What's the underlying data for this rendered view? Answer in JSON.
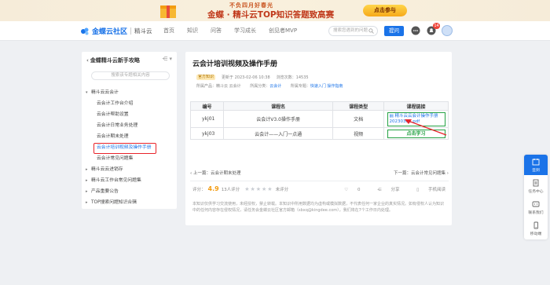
{
  "banner": {
    "subtitle": "不负四月好春光",
    "title": "金蝶 · 精斗云TOP知识答题致高赛",
    "cta": "点击参与"
  },
  "nav": {
    "brand": "金蝶云社区",
    "sub": "精斗云",
    "menu": [
      "首页",
      "知识",
      "问答",
      "学习成长",
      "创见者MVP"
    ],
    "search_placeholder": "搜索您遇到的问题",
    "ask_button": "提问",
    "notification_count": "14"
  },
  "sidebar": {
    "title": "金蝶精斗云新手攻略",
    "search_placeholder": "搜索该专题相关内容",
    "items": [
      {
        "label": "精斗云云会计",
        "level": 1,
        "caret": "▾"
      },
      {
        "label": "云会计工作台介绍",
        "level": 2
      },
      {
        "label": "云会计帮助设置",
        "level": 2
      },
      {
        "label": "云会计日常业务处理",
        "level": 2
      },
      {
        "label": "云会计期末处理",
        "level": 2
      },
      {
        "label": "云会计培训视频及操作手册",
        "level": 2,
        "active": true
      },
      {
        "label": "云会计常见问题集",
        "level": 2
      },
      {
        "label": "精斗云云进销存",
        "level": 1,
        "caret": "▸"
      },
      {
        "label": "精斗云工作台常见问题集",
        "level": 1,
        "caret": "▸"
      },
      {
        "label": "产品重要公告",
        "level": 1,
        "caret": "▸"
      },
      {
        "label": "TOP搜索问题知识合辑",
        "level": 1,
        "caret": "▸"
      }
    ]
  },
  "doc": {
    "title": "云会计培训视频及操作手册",
    "tag": "官方知识",
    "updated": "更新于 2023-02-06 10:38",
    "views": "浏览次数：14535",
    "product_label": "所属产品：",
    "product": "精斗云 云会计",
    "category_label": "所属分类：",
    "category": "云会计",
    "topic_label": "所属专题：",
    "topics": "快速入门  操作指南"
  },
  "table": {
    "headers": [
      "编号",
      "课程名",
      "课程类型",
      "课程链接"
    ],
    "rows": [
      {
        "no": "ykj01",
        "name": "云会计V3.0操作手册",
        "type": "文档",
        "link": "精斗云云会计操作手册20230301.pdf",
        "link_icon": "document-icon"
      },
      {
        "no": "ykj03",
        "name": "云会计——入门一点通",
        "type": "视频",
        "link": "点击学习"
      }
    ]
  },
  "pager": {
    "prev": "上一篇：云会计期末处理",
    "next": "下一篇：云会计常见问题集"
  },
  "rating": {
    "label": "评分：",
    "score": "4.9",
    "count": "13人评分",
    "stars": "★★★★★",
    "unrated": "未评分"
  },
  "actions": {
    "like": "0",
    "share": "分享",
    "mobile": "手机阅读"
  },
  "disclaimer": "本知识仅供学习交流使用，未经授权，禁止转载。本知识中所用数据均为虚构或模拟数据，不代表任何一家企业的真实情况。如有侵权人认为知识中的任何内容存在侵权情况，请任务会金蝶云社区官方邮箱（sbxq@kingdee.com），我们将在7个工作日内处理。",
  "floatbar": [
    {
      "label": "签到",
      "icon": "checkin-icon"
    },
    {
      "label": "任务中心",
      "icon": "task-icon"
    },
    {
      "label": "联系我们",
      "icon": "contact-icon"
    },
    {
      "label": "移动端",
      "icon": "mobile-icon"
    }
  ],
  "colors": {
    "accent": "#1a73e8",
    "highlight_red": "#e8232a",
    "highlight_green": "#25a244"
  }
}
